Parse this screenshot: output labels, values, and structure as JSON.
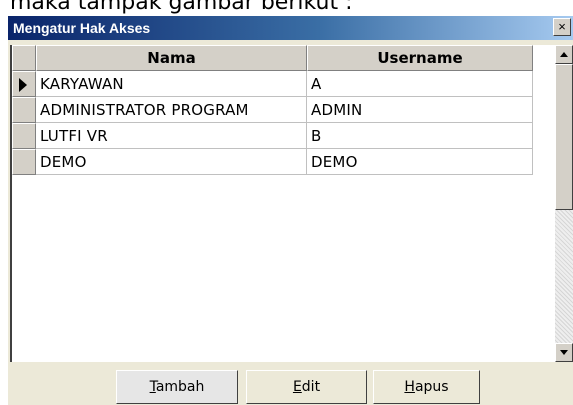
{
  "caption": "maka tampak gambar berikut :",
  "window": {
    "title": "Mengatur Hak Akses",
    "close_symbol": "×"
  },
  "grid": {
    "columns": [
      "Nama",
      "Username"
    ],
    "rows": [
      {
        "nama": "KARYAWAN",
        "username": "A",
        "current": true
      },
      {
        "nama": "ADMINISTRATOR PROGRAM",
        "username": "ADMIN",
        "current": false
      },
      {
        "nama": "LUTFI VR",
        "username": "B",
        "current": false
      },
      {
        "nama": "DEMO",
        "username": "DEMO",
        "current": false
      }
    ]
  },
  "buttons": {
    "tambah": "Tambah",
    "edit": "Edit",
    "hapus": "Hapus"
  },
  "icons": {
    "close": "close-icon",
    "row_pointer": "row-pointer-icon",
    "scroll_up": "arrow-up-icon",
    "scroll_down": "arrow-down-icon"
  }
}
